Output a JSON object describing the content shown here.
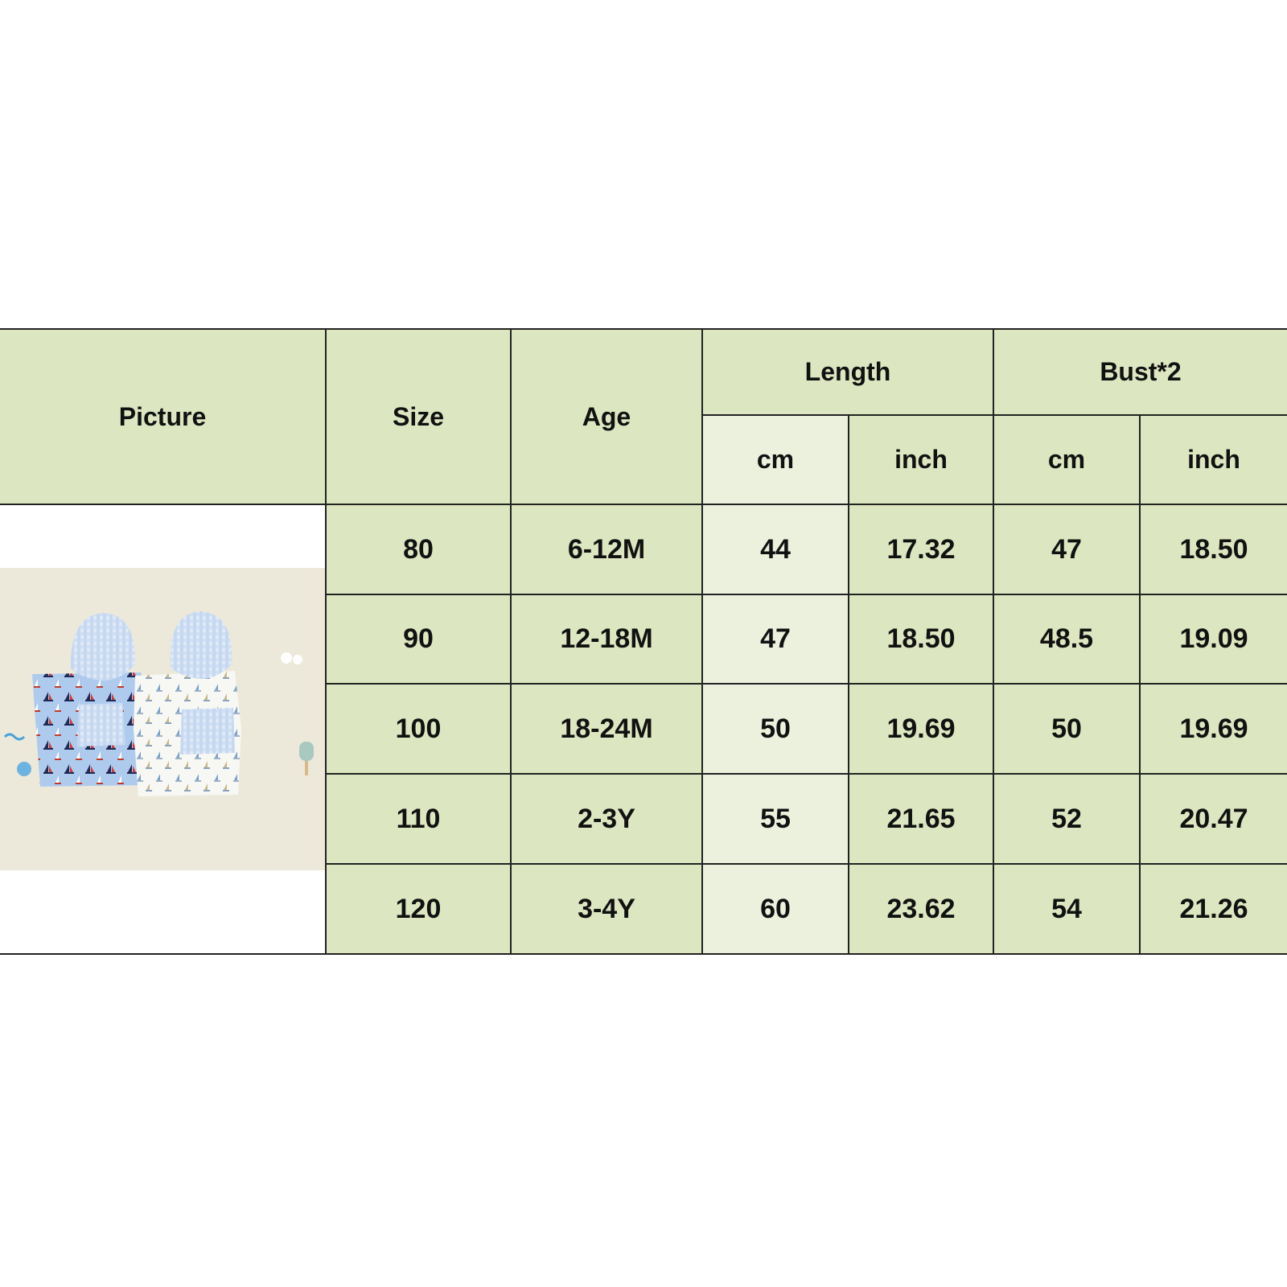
{
  "table": {
    "headers": {
      "picture": "Picture",
      "size": "Size",
      "age": "Age",
      "length": "Length",
      "bust": "Bust*2",
      "length_cm": "cm",
      "length_inch": "inch",
      "bust_cm": "cm",
      "bust_inch": "inch"
    },
    "rows": [
      {
        "size": "80",
        "age": "6-12M",
        "length_cm": "44",
        "length_inch": "17.32",
        "bust_cm": "47",
        "bust_inch": "18.50"
      },
      {
        "size": "90",
        "age": "12-18M",
        "length_cm": "47",
        "length_inch": "18.50",
        "bust_cm": "48.5",
        "bust_inch": "19.09"
      },
      {
        "size": "100",
        "age": "18-24M",
        "length_cm": "50",
        "length_inch": "19.69",
        "bust_cm": "50",
        "bust_inch": "19.69"
      },
      {
        "size": "110",
        "age": "2-3Y",
        "length_cm": "55",
        "length_inch": "21.65",
        "bust_cm": "52",
        "bust_inch": "20.47"
      },
      {
        "size": "120",
        "age": "3-4Y",
        "length_cm": "60",
        "length_inch": "23.62",
        "bust_cm": "54",
        "bust_inch": "21.26"
      }
    ]
  },
  "photo": {
    "subject": "two hooded baby beach ponchos with sailboat print",
    "colors": {
      "blue_poncho": "#aecbee",
      "white_poncho": "#f7f7f4",
      "background": "#ece9db"
    }
  },
  "colors": {
    "header_green": "#dce6c0",
    "light_green": "#ecf1de",
    "border": "#222222"
  }
}
